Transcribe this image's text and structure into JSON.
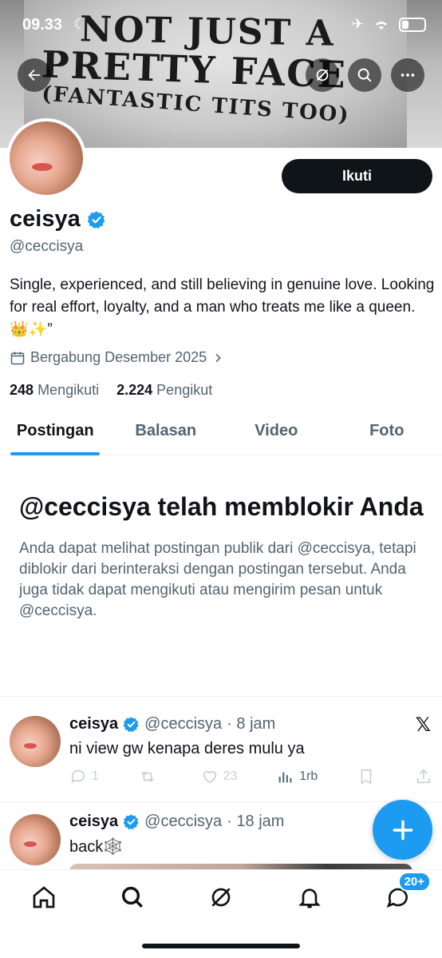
{
  "status_bar": {
    "time": "09.33"
  },
  "banner": {
    "shirt_lines": [
      "NOT JUST A",
      "PRETTY FACE",
      "(FANTASTIC TITS TOO)"
    ]
  },
  "profile": {
    "follow_label": "Ikuti",
    "name": "ceisya",
    "handle": "@ceccisya",
    "bio": "Single, experienced, and still believing in genuine love. Looking for real effort, loyalty, and a man who treats me like a queen. 👑✨”",
    "joined": "Bergabung Desember 2025",
    "following_count": "248",
    "following_label": "Mengikuti",
    "followers_count": "2.224",
    "followers_label": "Pengikut"
  },
  "tabs": [
    "Postingan",
    "Balasan",
    "Video",
    "Foto"
  ],
  "blocked_notice": {
    "title": "@ceccisya telah memblokir Anda",
    "body": "Anda dapat melihat postingan publik dari @ceccisya, tetapi diblokir dari berinteraksi dengan postingan tersebut. Anda juga tidak dapat mengikuti atau mengirim pesan untuk @ceccisya."
  },
  "posts": [
    {
      "name": "ceisya",
      "handle": "@ceccisya",
      "time": "· 8 jam",
      "text": "ni view gw kenapa deres mulu ya",
      "replies": "1",
      "reposts": "",
      "likes": "23",
      "views": "1rb"
    },
    {
      "name": "ceisya",
      "handle": "@ceccisya",
      "time": "· 18 jam",
      "text": "back🕸️"
    }
  ],
  "bottom_nav": {
    "messages_badge": "20+"
  },
  "colors": {
    "accent": "#1d9bf0",
    "text": "#0f1419",
    "muted": "#536471"
  }
}
